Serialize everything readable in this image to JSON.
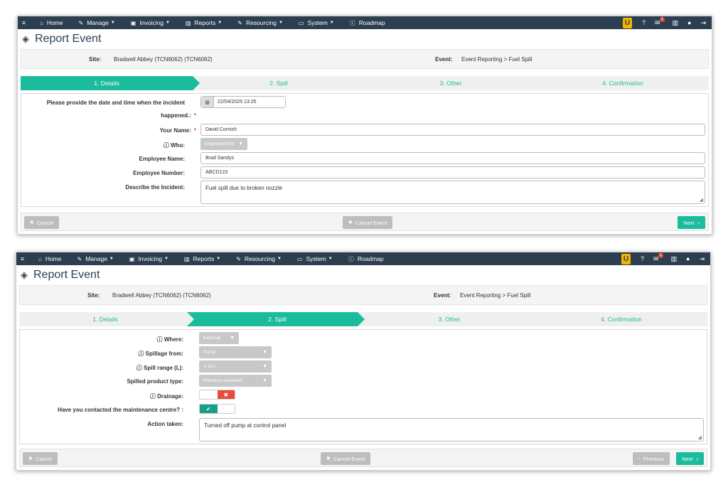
{
  "nav": {
    "menu_icon": "hamburger-icon",
    "items": [
      {
        "label": "Home",
        "icon": "home-icon"
      },
      {
        "label": "Manage",
        "icon": "wrench-icon"
      },
      {
        "label": "Invoicing",
        "icon": "invoice-icon"
      },
      {
        "label": "Reports",
        "icon": "bar-chart-icon"
      },
      {
        "label": "Resourcing",
        "icon": "wrench-icon"
      },
      {
        "label": "System",
        "icon": "monitor-icon"
      },
      {
        "label": "Roadmap",
        "icon": "info-icon"
      }
    ],
    "right_icons": [
      "brand-logo",
      "help-icon",
      "messages-icon",
      "stats-icon",
      "user-icon",
      "logout-icon"
    ],
    "message_badge": "1",
    "logo_letter": "U"
  },
  "page": {
    "title": "Report Event",
    "title_icon": "ticket-icon"
  },
  "info": {
    "site_label": "Site:",
    "site_value": "Bradwell Abbey (TCN6062) (TCN6062)",
    "event_label": "Event:",
    "event_value": "Event Reporting > Fuel Spill"
  },
  "steps": [
    "1. Details",
    "2. Spill",
    "3. Other",
    "4. Confirmation"
  ],
  "details_form": {
    "date_label_line1": "Please provide the date and time when the incident",
    "date_label_line2": "happened.:",
    "date_value": "22/04/2025 13:25",
    "name_label": "Your Name:",
    "name_value": "David Cornish",
    "who_label": "Who:",
    "who_value": "Employee/Site",
    "emp_name_label": "Employee Name:",
    "emp_name_value": "Brad Sandys",
    "emp_num_label": "Employee Number:",
    "emp_num_value": "ABCD123",
    "describe_label": "Describe the Incident:",
    "describe_value": "Fuel spill due to broken nozzle",
    "required_mark": "*"
  },
  "spill_form": {
    "where_label": "Where:",
    "where_value": "External",
    "spillage_label": "Spillage from:",
    "spillage_value": "Pump",
    "range_label": "Spill range (L):",
    "range_value": "1-10 L",
    "product_label": "Spilled product type:",
    "product_value": "Premium unleaded",
    "drainage_label": "Drainage:",
    "drainage_state": "no",
    "maintenance_label": "Have you contacted the maintenance centre? :",
    "maintenance_state": "yes",
    "action_label": "Action taken:",
    "action_value": "Turned off pump at control panel"
  },
  "buttons": {
    "cancel": "Cancel",
    "cancel_event": "Cancel Event",
    "next": "Next",
    "previous": "Previous"
  },
  "colors": {
    "navbar": "#2c3e50",
    "accent": "#1abc9c",
    "danger": "#e74c3c",
    "confirm": "#16a085",
    "logo": "#f5b400"
  }
}
